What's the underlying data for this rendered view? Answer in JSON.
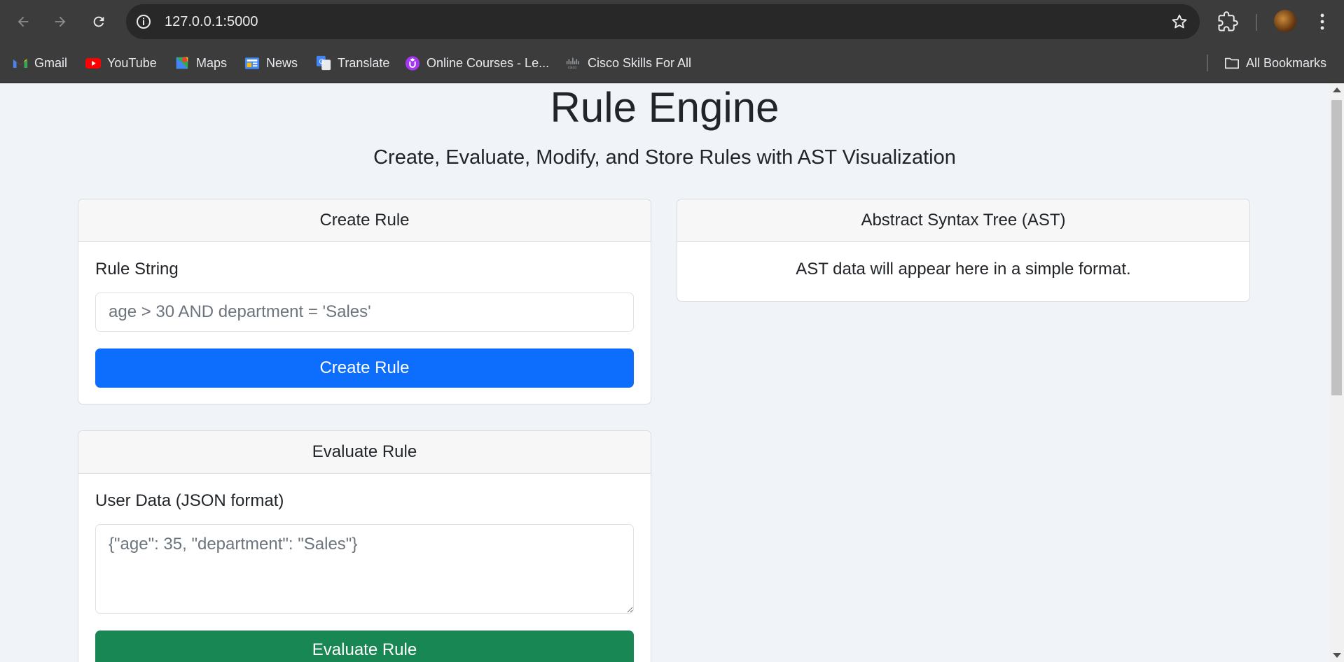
{
  "browser": {
    "url": "127.0.0.1:5000",
    "bookmarks": [
      {
        "label": "Gmail",
        "icon": "gmail-icon"
      },
      {
        "label": "YouTube",
        "icon": "youtube-icon"
      },
      {
        "label": "Maps",
        "icon": "maps-icon"
      },
      {
        "label": "News",
        "icon": "news-icon"
      },
      {
        "label": "Translate",
        "icon": "translate-icon"
      },
      {
        "label": "Online Courses - Le...",
        "icon": "udemy-icon"
      },
      {
        "label": "Cisco Skills For All",
        "icon": "cisco-icon"
      }
    ],
    "all_bookmarks": "All Bookmarks"
  },
  "page": {
    "title": "Rule Engine",
    "subtitle": "Create, Evaluate, Modify, and Store Rules with AST Visualization"
  },
  "create_rule": {
    "header": "Create Rule",
    "label": "Rule String",
    "placeholder": "age > 30 AND department = 'Sales'",
    "button": "Create Rule"
  },
  "evaluate_rule": {
    "header": "Evaluate Rule",
    "label": "User Data (JSON format)",
    "placeholder": "{\"age\": 35, \"department\": \"Sales\"}",
    "button": "Evaluate Rule"
  },
  "ast": {
    "header": "Abstract Syntax Tree (AST)",
    "text": "AST data will appear here in a simple format."
  },
  "colors": {
    "primary": "#0d6efd",
    "success": "#198754",
    "page_bg": "#f0f3f7",
    "chrome_bg": "#3c3c3c"
  }
}
